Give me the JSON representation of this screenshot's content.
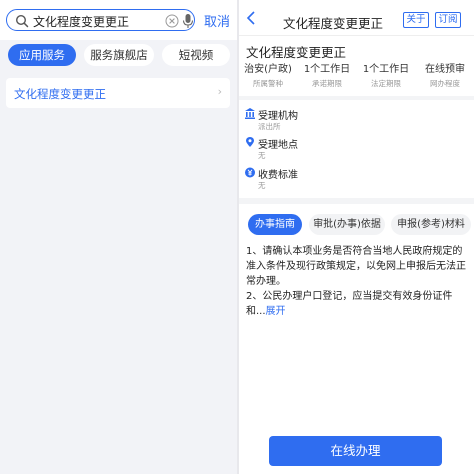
{
  "search": {
    "query": "文化程度变更更正",
    "cancel_label": "取消"
  },
  "tabs": [
    {
      "label": "应用服务",
      "active": true
    },
    {
      "label": "服务旗舰店",
      "active": false
    },
    {
      "label": "短视频",
      "active": false
    }
  ],
  "results": [
    {
      "label": "文化程度变更更正"
    }
  ],
  "detail": {
    "nav_title": "文化程度变更更正",
    "about_label": "关于",
    "subscribe_label": "订阅",
    "title": "文化程度变更更正",
    "meta": [
      {
        "value": "治安(户政)",
        "key": "所属警种"
      },
      {
        "value": "1个工作日",
        "key": "承诺期限"
      },
      {
        "value": "1个工作日",
        "key": "法定期限"
      },
      {
        "value": "在线预审",
        "key": "网办程度"
      }
    ],
    "info": [
      {
        "icon": "building-icon",
        "label": "受理机构",
        "value": "派出所"
      },
      {
        "icon": "location-pin-icon",
        "label": "受理地点",
        "value": "无"
      },
      {
        "icon": "yen-icon",
        "label": "收费标准",
        "value": "无"
      }
    ],
    "doc_tabs": [
      {
        "label": "办事指南",
        "active": true
      },
      {
        "label": "审批(办事)依据",
        "active": false
      },
      {
        "label": "申报(参考)材料",
        "active": false
      }
    ],
    "guide_lines": [
      "1、请确认本项业务是否符合当地人民政府规定的准入条件及现行政策规定，以免网上申报后无法正常办理。",
      "2、公民办理户口登记，应当提交有效身份证件和..."
    ],
    "expand_label": "展开",
    "online_button": "在线办理"
  },
  "colors": {
    "accent": "#2f6df0",
    "background": "#f2f3f7"
  }
}
